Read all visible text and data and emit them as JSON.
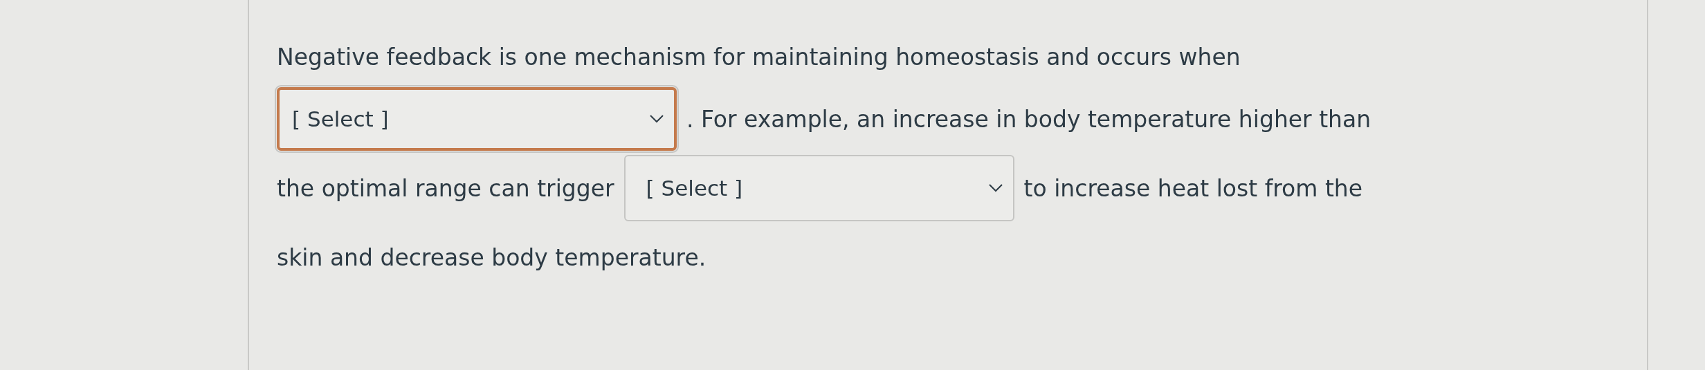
{
  "question": {
    "lines": [
      [
        {
          "kind": "text",
          "text": "Negative feedback is one mechanism for maintaining homeostasis and occurs when"
        }
      ],
      [
        {
          "kind": "select",
          "placeholder": "[ Select ]",
          "focused": true
        },
        {
          "kind": "text",
          "text": ". For example, an increase in body temperature higher than"
        }
      ],
      [
        {
          "kind": "text",
          "text": "the optimal range can trigger"
        },
        {
          "kind": "select",
          "placeholder": "[ Select ]",
          "focused": false
        },
        {
          "kind": "text",
          "text": "to increase heat lost from the"
        }
      ],
      [
        {
          "kind": "text",
          "text": "skin and decrease body temperature."
        }
      ]
    ]
  }
}
